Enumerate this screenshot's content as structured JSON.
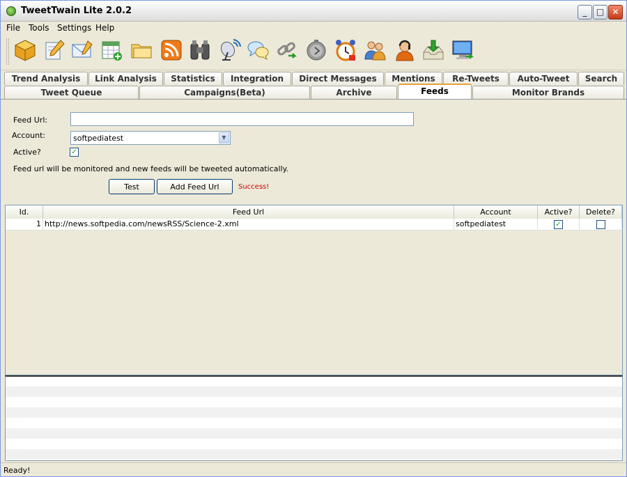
{
  "window": {
    "title": "TweetTwain Lite 2.0.2"
  },
  "menu": [
    "File",
    "Tools",
    "Settings",
    "Help"
  ],
  "toolbar": {
    "icons": [
      "package-icon",
      "compose-icon",
      "mail-icon",
      "calendar-add-icon",
      "folder-icon",
      "rss-icon",
      "binoculars-icon",
      "antenna-icon",
      "chat-icon",
      "link-icon",
      "timer-icon",
      "alarm-clock-icon",
      "users-icon",
      "support-agent-icon",
      "inbox-add-icon",
      "monitor-icon"
    ]
  },
  "tabs_row1": [
    "Trend Analysis",
    "Link Analysis",
    "Statistics",
    "Integration",
    "Direct Messages",
    "Mentions",
    "Re-Tweets",
    "Auto-Tweet",
    "Search"
  ],
  "tabs_row2": [
    "Tweet Queue",
    "Campaigns(Beta)",
    "Archive",
    "Feeds",
    "Monitor Brands"
  ],
  "active_tab": "Feeds",
  "form": {
    "feed_url_label": "Feed Url:",
    "feed_url_value": "",
    "account_label": "Account:",
    "account_value": "softpediatest",
    "active_label": "Active?",
    "active_checked": true,
    "info": "Feed url will be monitored and new feeds will be tweeted automatically.",
    "test_button": "Test",
    "add_button": "Add Feed Url",
    "success_text": "Success!"
  },
  "table": {
    "headers": [
      "Id.",
      "Feed Url",
      "Account",
      "Active?",
      "Delete?"
    ],
    "rows": [
      {
        "id": "1",
        "url": "http://news.softpedia.com/newsRSS/Science-2.xml",
        "account": "softpediatest",
        "active": true,
        "delete": false
      }
    ]
  },
  "status": "Ready!"
}
